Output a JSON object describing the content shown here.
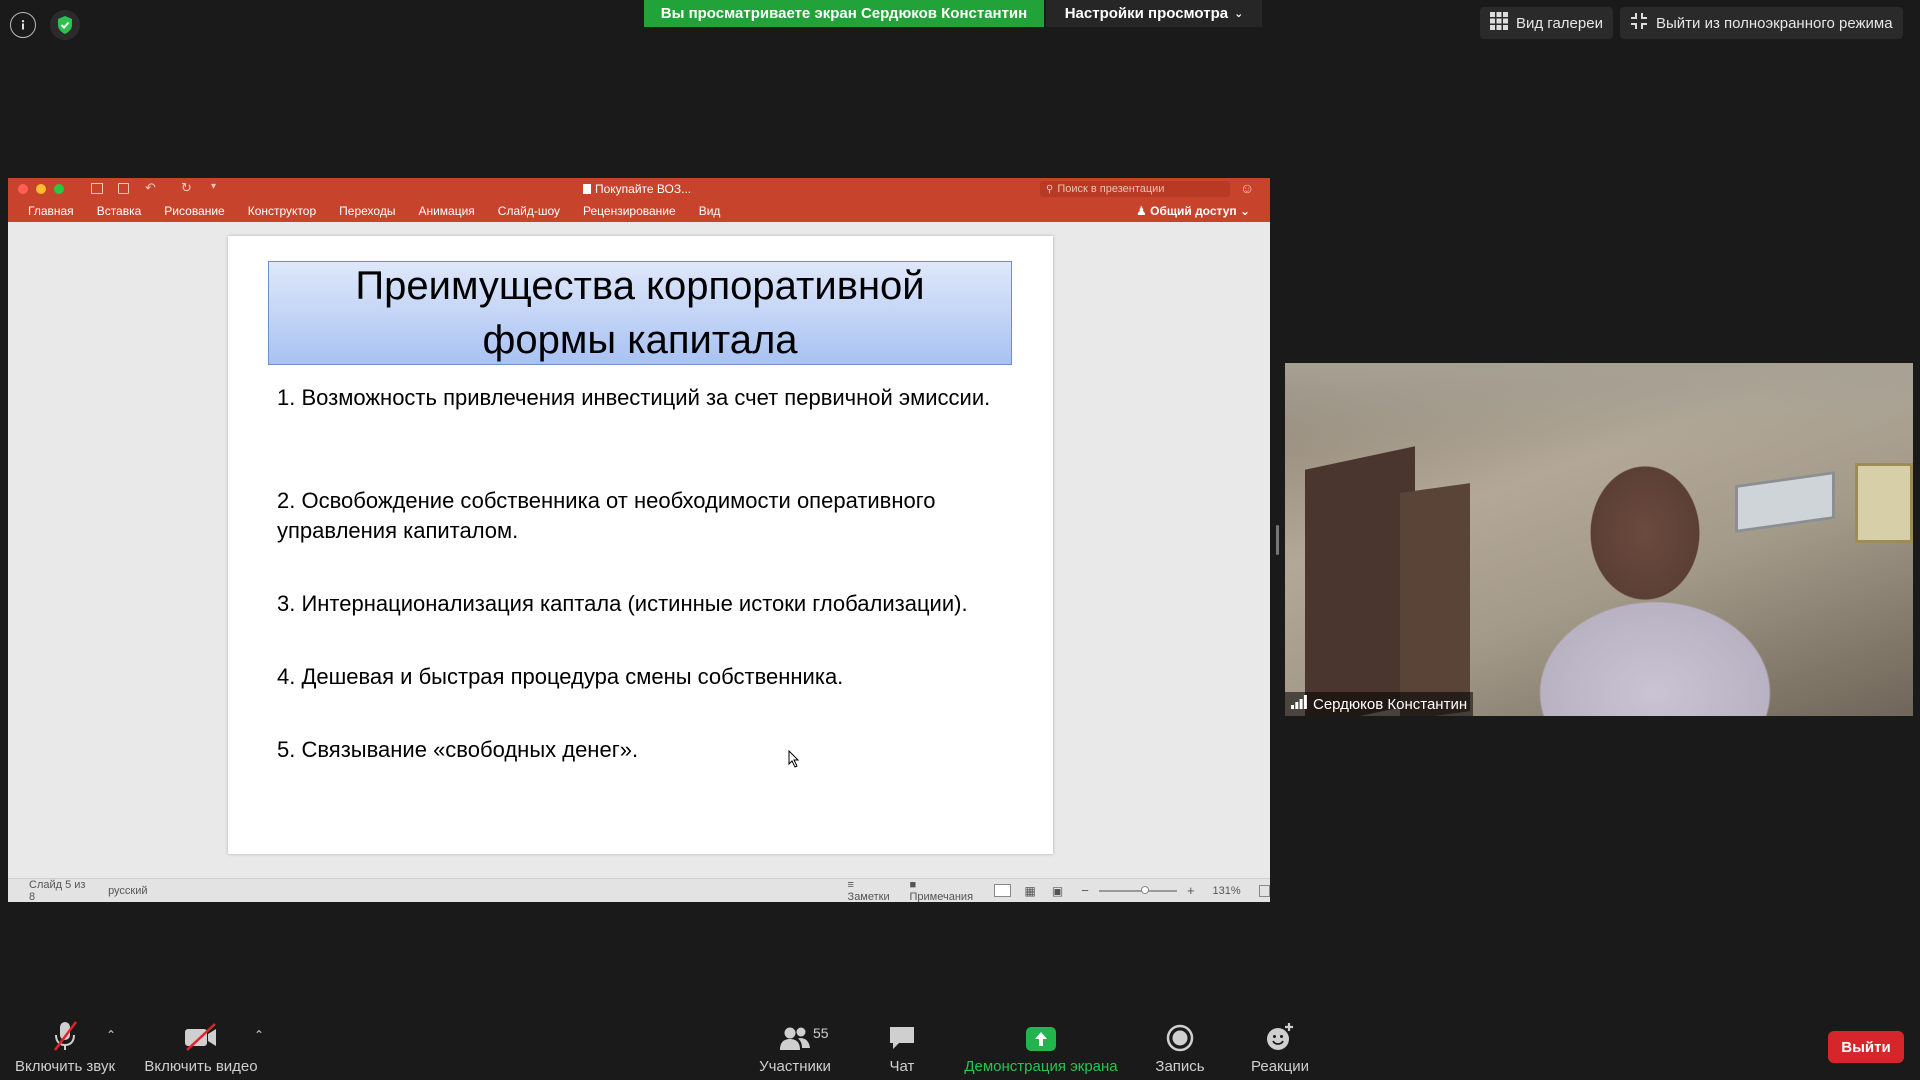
{
  "top": {
    "sharing_banner": "Вы просматриваете экран Сердюков Константин",
    "view_settings": "Настройки просмотра",
    "gallery_view": "Вид галереи",
    "exit_fullscreen": "Выйти из полноэкранного режима"
  },
  "ppt": {
    "window_title": "Покупайте ВОЗ...",
    "search_placeholder": "Поиск в презентации",
    "ribbon_tabs": [
      "Главная",
      "Вставка",
      "Рисование",
      "Конструктор",
      "Переходы",
      "Анимация",
      "Слайд-шоу",
      "Рецензирование",
      "Вид"
    ],
    "share": "Общий доступ",
    "slide": {
      "title": "Преимущества корпоративной формы капитала",
      "items": [
        "1. Возможность привлечения инвестиций за счет первичной эмиссии.",
        "2. Освобождение собственника от необходимости оперативного управления капиталом.",
        "3. Интернационализация каптала (истинные истоки глобализации).",
        "4. Дешевая и быстрая процедура смены собственника.",
        "5. Связывание «свободных денег»."
      ]
    },
    "status": {
      "slide_counter": "Слайд 5 из 8",
      "language": "русский",
      "notes": "Заметки",
      "comments": "Примечания",
      "zoom": "131%"
    }
  },
  "video": {
    "participant_name": "Сердюков Константин"
  },
  "toolbar": {
    "unmute": "Включить звук",
    "start_video": "Включить видео",
    "participants": "Участники",
    "participants_count": "55",
    "chat": "Чат",
    "share_screen": "Демонстрация экрана",
    "record": "Запись",
    "reactions": "Реакции",
    "leave": "Выйти"
  },
  "colors": {
    "share_green": "#22a339",
    "leave_red": "#d7262b",
    "ppt_red": "#c8432b"
  }
}
